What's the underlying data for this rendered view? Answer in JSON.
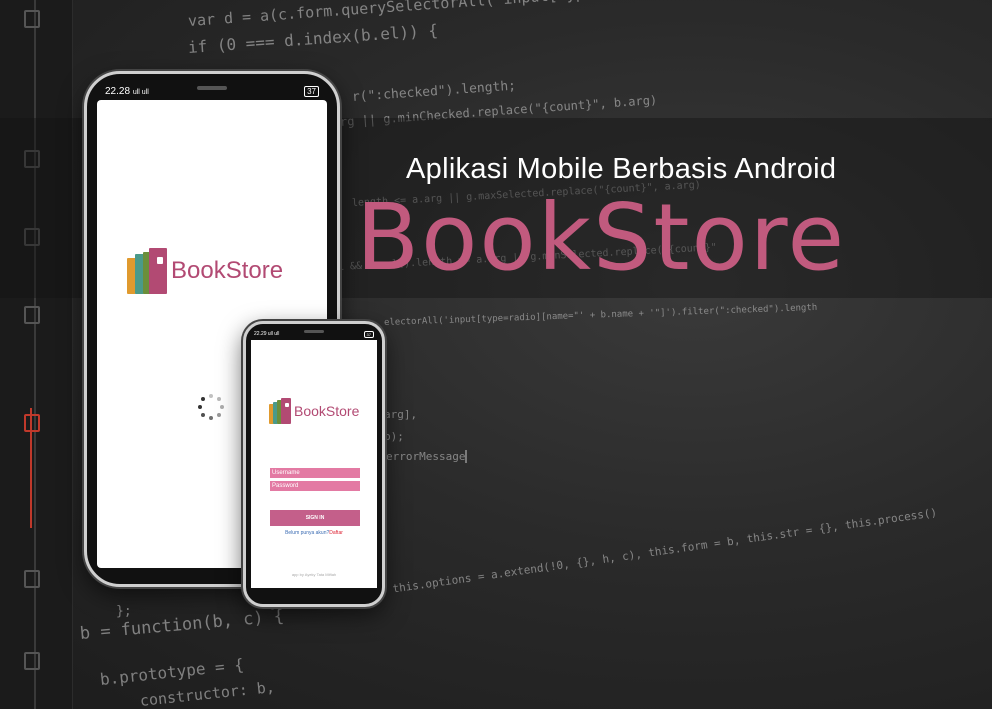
{
  "hero": {
    "subtitle": "Aplikasi Mobile Berbasis Android",
    "title": "BookStore"
  },
  "code_lines": [
    "var d = a(c.form.querySelectorAll(\"input[type=checkbox][name=\" + b.el.name + \"]\"));",
    "if (0 === d.index(b.el)) {",
    "r(\":checked\").length;",
    "rg || g.minChecked.replace(\"{count}\", b.arg)",
    "length <= a.arg || g.maxSelected.replace(\"{count}\", a.arg)",
    "1 && a.val().length >= a.arg || g.minSelected.replace(\"{count}\"",
    "electorAll('input[type=radio][name=\"' + b.name + '\"]').filter(\":checked\").length",
    "arg],",
    "b);",
    "errorMessage",
    "};",
    "b = function(b, c) {",
    "this.handler = !1, this.options = a.extend(!0, {}, h, c), this.form = b, this.str = {}, this.process()",
    "b.prototype = {",
    "constructor: b,"
  ],
  "phone_large": {
    "status_time": "22.28",
    "status_signal": "ull ull",
    "battery": "37",
    "logo_text": "BookStore"
  },
  "phone_small": {
    "status_time": "22.29",
    "status_signal": "ull ull",
    "battery": "37",
    "logo_text": "BookStore",
    "username_placeholder": "Username",
    "password_placeholder": "Password",
    "signin_label": "SIGN IN",
    "register_prompt": "Belum punya akun?",
    "register_link": "Daftar",
    "credit": "app by Ayeky Tata Miftah"
  },
  "colors": {
    "brand": "#c15a7e",
    "field": "#e37aa3",
    "button": "#c45f8a",
    "link": "#3b6cb3",
    "register_link": "#dd2233"
  }
}
